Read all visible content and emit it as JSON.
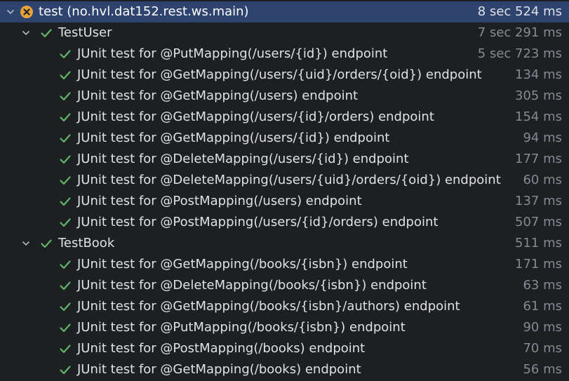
{
  "root": {
    "label": "test (no.hvl.dat152.rest.ws.main)",
    "time": "8 sec 524 ms",
    "status": "failed",
    "icon": "error-x-icon"
  },
  "suites": [
    {
      "label": "TestUser",
      "time": "7 sec 291 ms",
      "status": "passed",
      "tests": [
        {
          "label": "JUnit test for @PutMapping(/users/{id}) endpoint",
          "time": "5 sec 723 ms"
        },
        {
          "label": "JUnit test for @GetMapping(/users/{uid}/orders/{oid}) endpoint",
          "time": "134 ms"
        },
        {
          "label": "JUnit test for @GetMapping(/users) endpoint",
          "time": "305 ms"
        },
        {
          "label": "JUnit test for @GetMapping(/users/{id}/orders) endpoint",
          "time": "154 ms"
        },
        {
          "label": "JUnit test for @GetMapping(/users/{id}) endpoint",
          "time": "94 ms"
        },
        {
          "label": "JUnit test for @DeleteMapping(/users/{id}) endpoint",
          "time": "177 ms"
        },
        {
          "label": "JUnit test for @DeleteMapping(/users/{uid}/orders/{oid}) endpoint",
          "time": "60 ms"
        },
        {
          "label": "JUnit test for @PostMapping(/users) endpoint",
          "time": "137 ms"
        },
        {
          "label": "JUnit test for @PostMapping(/users/{id}/orders) endpoint",
          "time": "507 ms"
        }
      ]
    },
    {
      "label": "TestBook",
      "time": "511 ms",
      "status": "passed",
      "tests": [
        {
          "label": "JUnit test for @GetMapping(/books/{isbn}) endpoint",
          "time": "171 ms"
        },
        {
          "label": "JUnit test for @DeleteMapping(/books/{isbn}) endpoint",
          "time": "63 ms"
        },
        {
          "label": "JUnit test for @GetMapping(/books/{isbn}/authors) endpoint",
          "time": "61 ms"
        },
        {
          "label": "JUnit test for @PutMapping(/books/{isbn}) endpoint",
          "time": "90 ms"
        },
        {
          "label": "JUnit test for @PostMapping(/books) endpoint",
          "time": "70 ms"
        },
        {
          "label": "JUnit test for @GetMapping(/books) endpoint",
          "time": "56 ms"
        }
      ]
    }
  ],
  "icons": {
    "expanded": "chevron-down-icon",
    "passed": "check-icon",
    "failed": "error-x-icon"
  },
  "colors": {
    "selected_row": "#2e436e",
    "pass_green": "#5fb865",
    "fail_orange": "#e5a33c",
    "text": "#dfe1e5",
    "muted": "#868a91",
    "background": "#1e1f22"
  }
}
